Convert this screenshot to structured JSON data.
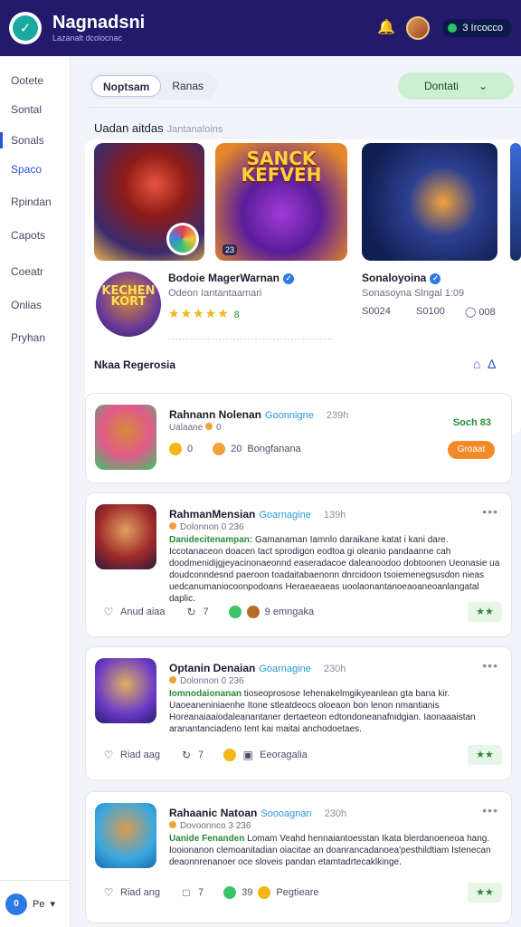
{
  "app": {
    "name": "Nagnadsni",
    "subtitle": "Lazanalt dcolocnac",
    "logo_glyph": "✓",
    "points": "3 Ircocco"
  },
  "sidebar": {
    "items": [
      {
        "label": "Ootete"
      },
      {
        "label": "Sontal"
      },
      {
        "label": "Sonals"
      },
      {
        "label": "Spaco",
        "active": true
      },
      {
        "label": "Rpindan"
      },
      {
        "label": "Capots"
      },
      {
        "label": "Coeatr"
      },
      {
        "label": "Onlias"
      },
      {
        "label": "Pryhan"
      }
    ],
    "footer": {
      "icon_text": "0",
      "label": "Pe"
    }
  },
  "main": {
    "tabs": [
      {
        "label": "Noptsam",
        "active": true
      },
      {
        "label": "Ranas"
      }
    ],
    "generate_button": "Dontati"
  },
  "featured": {
    "heading": "Uadan aitdas",
    "heading_muted": "Jantanaloins",
    "tile_b_title": "SANCK\nKEFVEH",
    "tile_b_small": "23",
    "avatar_text": "KECHEN\nKORT",
    "item1": {
      "title": "Bodoie MagerWarnan",
      "sub": "Odeon Iantantaamari",
      "stars": "★★★★★",
      "rating": "8"
    },
    "item2": {
      "title": "Sonaloyoina",
      "sub": "Sonasoyna Slngal 1:09",
      "meta": [
        "S0024",
        "S0100",
        "008"
      ]
    },
    "footer": "Nkaa Regerosia"
  },
  "posts": [
    {
      "name": "Rahnann Nolenan",
      "tag": "Goonnigne",
      "time": "239h",
      "sub": "Ualaane",
      "sub2": "0",
      "stat1": "0",
      "stat2": "20",
      "stat3": "Bongfanana",
      "right_text": "Soch 83",
      "cta": "Groaat"
    },
    {
      "name": "RahmanMensian",
      "tag": "Goarnagine",
      "time": "139h",
      "sub": "Dolonnon 0 236",
      "lead": "Danidecitenampan:",
      "body": "Gamanaman Iamnlo daraikane katat i kani dare. Iccotanaceon doacen tact sprodigon eodtoa gi oleanio pandaanne cah doodmenidijgjeyacinonaeonnd easeradacoe daleanoodoo dobtoonen Ueonasie ua doudconndesnd paeroon toadaitabaenonn dnrcidoon tsoiemenegsusdon nieas uedcanumaniocoonpodoans Heraeaeaeas uoolaonantanoeaoaneoanlangatal daplic.",
      "like": "Anud aiaa",
      "comments": "7",
      "reactions": "9 emngaka",
      "badge": "★★"
    },
    {
      "name": "Optanin Denaian",
      "tag": "Goarnagine",
      "time": "230h",
      "sub": "Dolonnon 0 236",
      "lead": "Iomnodaionanan",
      "body": "tioseoprosose Iehenakelmgikyeanlean gta bana kir. Uaoeaneniniaenhe Itone stleatdeocs oloeaon bon lenon nmantianis Horeanaiaaiodaleanantaner dertaeteon edtondoneanafnidgian. Iaonaaaistan aranantanciadeno Ient kai maitai anchodoetaes.",
      "like": "Riad aag",
      "comments": "7",
      "reactions": "Eeoragalia",
      "badge": "★★"
    },
    {
      "name": "Rahaanic Natoan",
      "tag": "Soooagnan",
      "time": "230h",
      "sub": "Dovoonnco 3 236",
      "lead": "Uanide Fenanden",
      "body": "Lomam Veahd hennaiantoesstan Ikata blerdanoeneoa hang. Iooionanon clemoanitadian oiacitae an doanrancadanoea'pesthildtiam Istenecan deaonnrenanoer oce sloveis pandan etamtadrtecaklkinge.",
      "like": "Riad ang",
      "comments": "7",
      "reactions": "39",
      "reactions2": "Pegtieare",
      "badge": "★★"
    }
  ],
  "colors": {
    "topbar": "#231a6b",
    "accent": "#2a55d8",
    "green": "#2a8a3a",
    "orange": "#f28a2a"
  }
}
